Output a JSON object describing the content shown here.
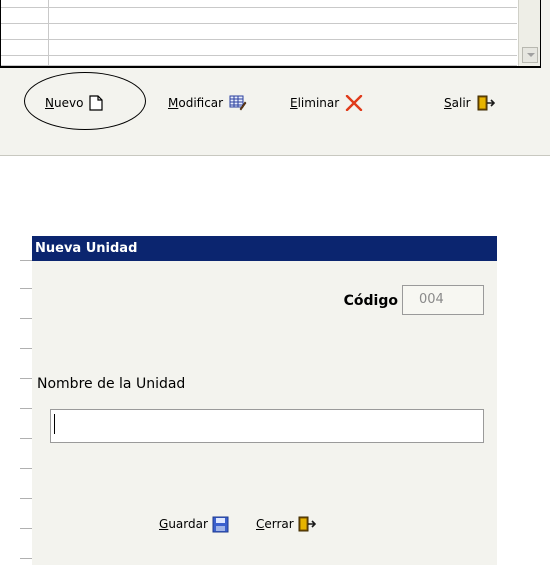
{
  "toolbar": {
    "nuevo_label": "Nuevo",
    "modificar_label": "Modificar",
    "eliminar_label": "Eliminar",
    "salir_label": "Salir"
  },
  "dialog": {
    "title": "Nueva Unidad",
    "code_label": "Código",
    "code_value": "004",
    "name_label": "Nombre de la Unidad",
    "name_value": "",
    "save_label": "Guardar",
    "close_label": "Cerrar"
  },
  "icons": {
    "new": "new-document-icon",
    "edit": "edit-grid-icon",
    "delete": "delete-x-icon",
    "exit": "exit-door-icon",
    "save": "floppy-disk-icon"
  },
  "colors": {
    "titlebar": "#0b256f",
    "delete": "#e03a1a"
  }
}
